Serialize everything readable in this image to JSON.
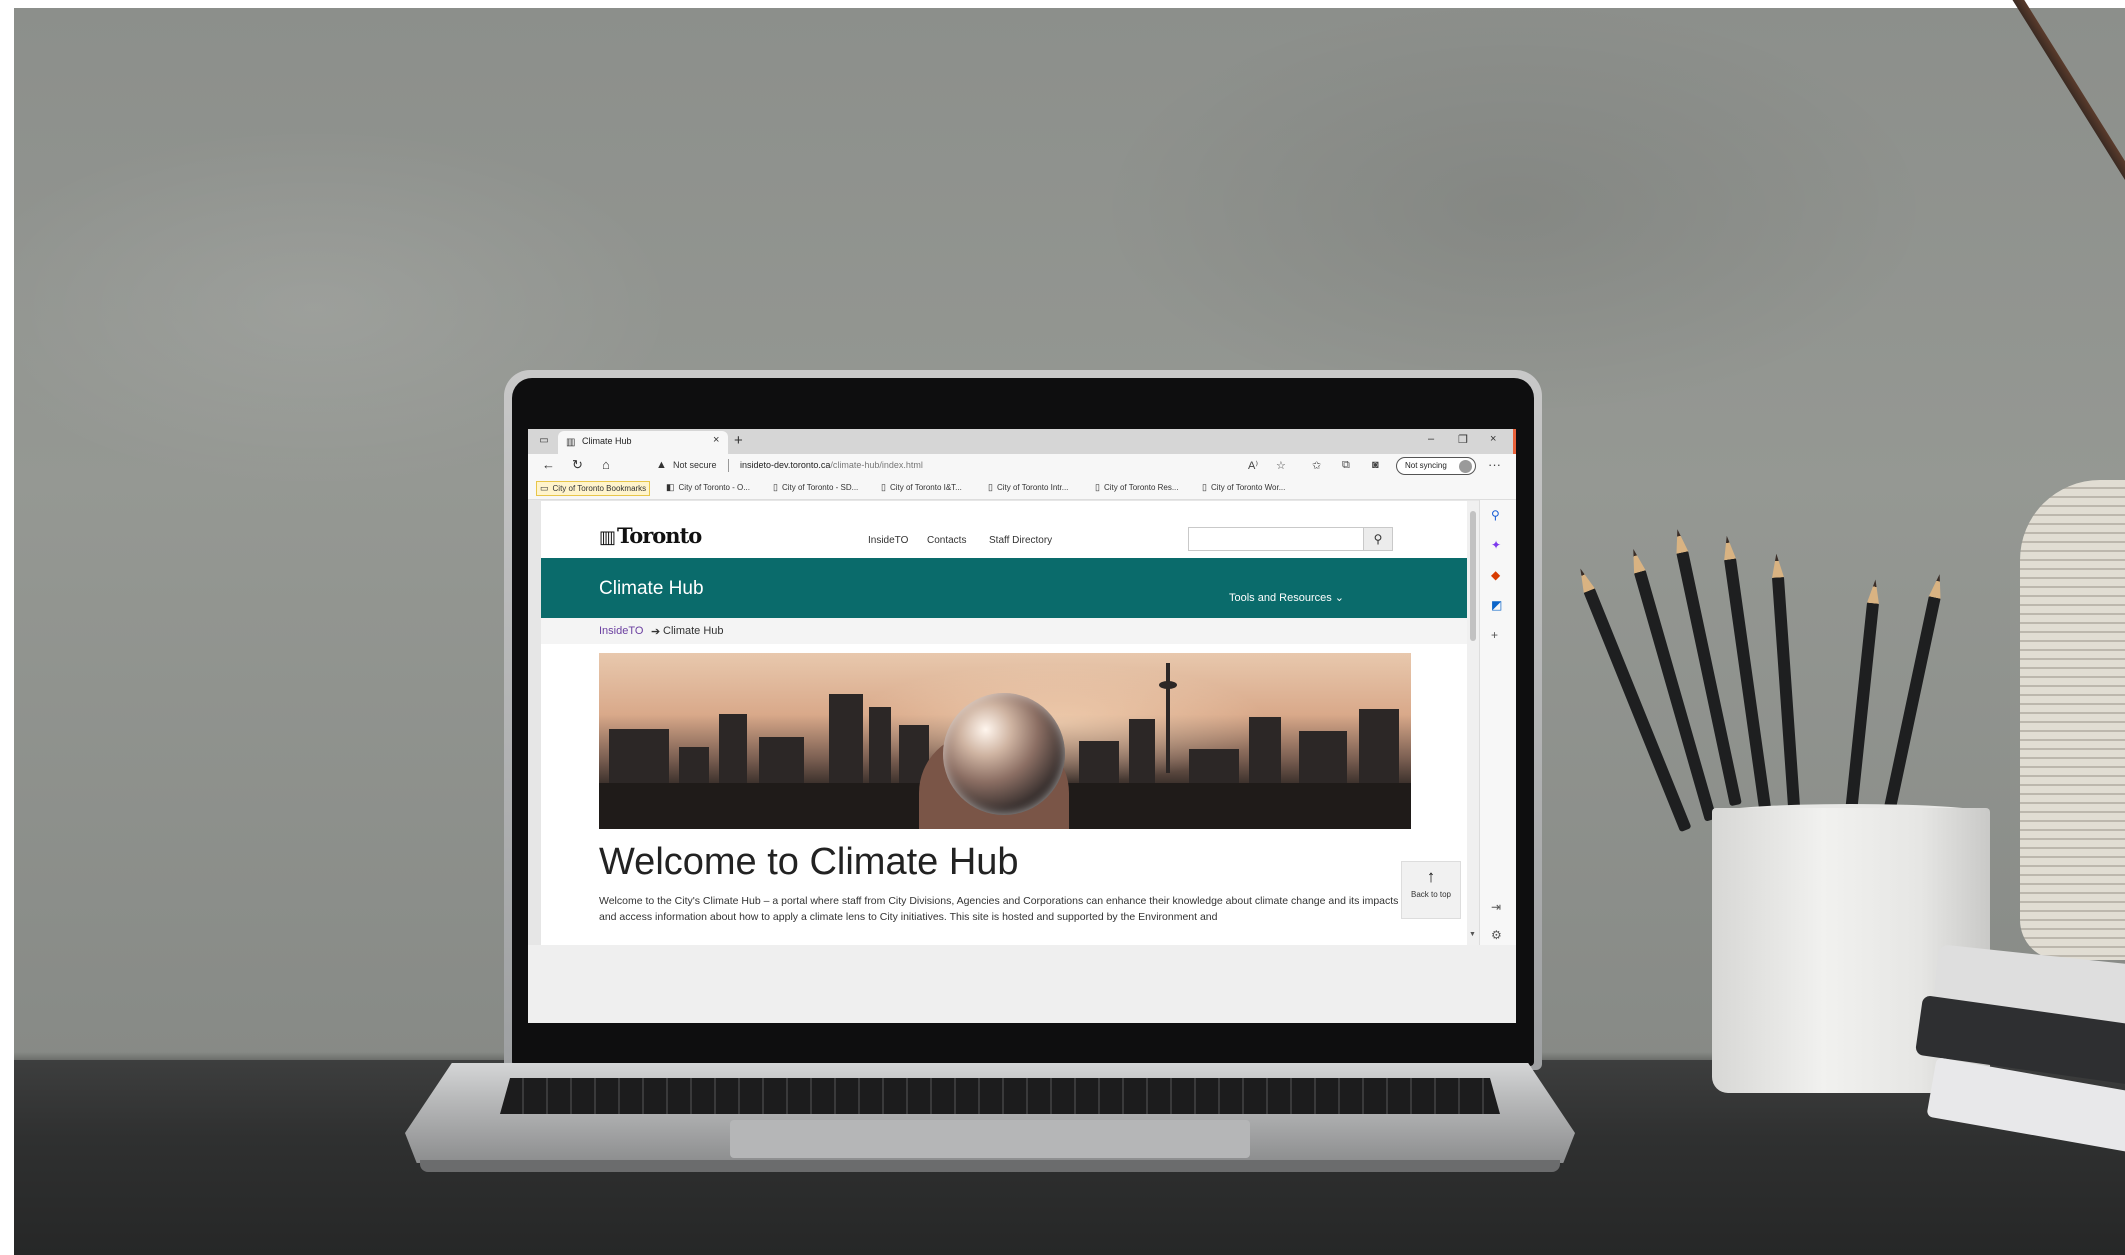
{
  "browser": {
    "tab_title": "Climate Hub",
    "tab_close": "×",
    "new_tab": "+",
    "window_minimize": "–",
    "window_restore": "❐",
    "window_close": "×",
    "not_secure": "Not secure",
    "url_host": "insideto-dev.toronto.ca",
    "url_path": "/climate-hub/index.html",
    "sync_label": "Not syncing",
    "more_menu": "···",
    "bookmarks": [
      {
        "label": "City of Toronto Bookmarks",
        "icon": "folder-icon"
      },
      {
        "label": "City of Toronto - O...",
        "icon": "sharepoint-icon"
      },
      {
        "label": "City of Toronto - SD...",
        "icon": "page-icon"
      },
      {
        "label": "City of Toronto I&T...",
        "icon": "page-icon"
      },
      {
        "label": "City of Toronto Intr...",
        "icon": "page-icon"
      },
      {
        "label": "City of Toronto Res...",
        "icon": "page-icon"
      },
      {
        "label": "City of Toronto Wor...",
        "icon": "page-icon"
      }
    ]
  },
  "site": {
    "logo_text": "Toronto",
    "nav": [
      "InsideTO",
      "Contacts",
      "Staff Directory"
    ],
    "search_placeholder": "",
    "title": "Climate Hub",
    "tools_menu": "Tools and Resources ⌄"
  },
  "breadcrumb": {
    "link": "InsideTO",
    "separator": "➔",
    "current": "Climate Hub"
  },
  "content": {
    "heading": "Welcome to Climate Hub",
    "intro": "Welcome to the City's Climate Hub – a portal where staff from City Divisions, Agencies and Corporations can enhance their knowledge about climate change and its impacts and access information about how to apply a climate lens to City initiatives. This site is hosted and supported by the Environment and",
    "back_to_top": "Back to top"
  },
  "colors": {
    "teal_band": "#0a6b6b",
    "breadcrumb_link": "#6b3fa0",
    "window_accent": "#e8613a"
  }
}
